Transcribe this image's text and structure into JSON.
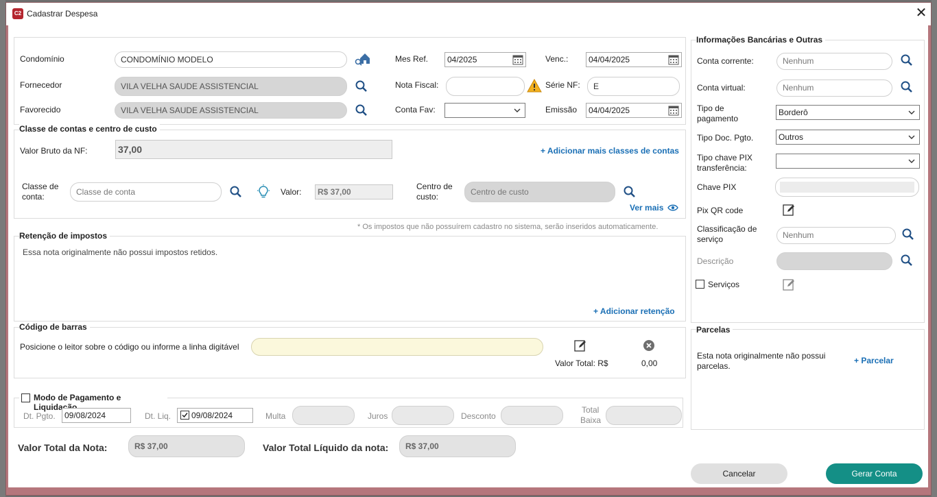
{
  "window": {
    "title": "Cadastrar Despesa",
    "close": "✕",
    "app_icon": "C2"
  },
  "top": {
    "condominio_label": "Condomínio",
    "condominio_value": "CONDOMÍNIO MODELO",
    "fornecedor_label": "Fornecedor",
    "fornecedor_value": "VILA VELHA SAUDE ASSISTENCIAL",
    "favorecido_label": "Favorecido",
    "favorecido_value": "VILA VELHA SAUDE ASSISTENCIAL",
    "mes_ref_label": "Mes Ref.",
    "mes_ref_value": "04/2025",
    "nota_fiscal_label": "Nota Fiscal:",
    "nota_fiscal_value": "",
    "conta_fav_label": "Conta Fav:",
    "conta_fav_value": "",
    "venc_label": "Venc.:",
    "venc_value": "04/04/2025",
    "serie_nf_label": "Série NF:",
    "serie_nf_value": "E",
    "emissao_label": "Emissão",
    "emissao_value": "04/04/2025"
  },
  "classes": {
    "title": "Classe de contas e centro de custo",
    "valor_bruto_label": "Valor Bruto da NF:",
    "valor_bruto_value": "37,00",
    "add_link": "+ Adicionar mais classes de contas",
    "classe_label_1": "Classe de",
    "classe_label_2": "conta:",
    "classe_placeholder": "Classe de conta",
    "valor_label": "Valor:",
    "valor_value": "R$ 37,00",
    "centro_label_1": "Centro de",
    "centro_label_2": "custo:",
    "centro_placeholder": "Centro de custo",
    "ver_mais": "Ver mais",
    "note": "* Os impostos que não possuírem cadastro no sistema, serão inseridos automaticamente."
  },
  "retencao": {
    "title": "Retenção de impostos",
    "text": "Essa nota originalmente não possui impostos retidos.",
    "add_link": "+ Adicionar retenção"
  },
  "barcode": {
    "title": "Código de barras",
    "label": "Posicione o leitor sobre o código ou informe a linha digitável",
    "value": "",
    "valor_total_label": "Valor Total: R$",
    "valor_total_value": "0,00"
  },
  "pagamento": {
    "title": "Modo de Pagamento e Liquidação",
    "dt_pgto_label": "Dt. Pgto.",
    "dt_pgto_value": "09/08/2024",
    "dt_liq_label": "Dt. Liq.",
    "dt_liq_value": "09/08/2024",
    "multa_label": "Multa",
    "juros_label": "Juros",
    "desconto_label": "Desconto",
    "total_baixa_label_1": "Total",
    "total_baixa_label_2": "Baixa"
  },
  "totals": {
    "valor_total_label": "Valor Total da Nota:",
    "valor_total_value": "R$ 37,00",
    "valor_liquido_label": "Valor Total Líquido da nota:",
    "valor_liquido_value": "R$ 37,00"
  },
  "banco": {
    "title": "Informações Bancárias e Outras",
    "conta_corrente_label": "Conta corrente:",
    "conta_corrente_placeholder": "Nenhum",
    "conta_virtual_label": "Conta virtual:",
    "conta_virtual_placeholder": "Nenhum",
    "tipo_pagamento_label_1": "Tipo de",
    "tipo_pagamento_label_2": "pagamento",
    "tipo_pagamento_value": "Borderô",
    "tipo_doc_label": "Tipo Doc. Pgto.",
    "tipo_doc_value": "Outros",
    "tipo_pix_label_1": "Tipo chave PIX",
    "tipo_pix_label_2": "transferência:",
    "tipo_pix_value": "",
    "chave_pix_label": "Chave PIX",
    "pix_qr_label": "Pix QR code",
    "classificacao_label_1": "Classificação de",
    "classificacao_label_2": "serviço",
    "classificacao_placeholder": "Nenhum",
    "descricao_label": "Descrição",
    "servicos_label": "Serviços"
  },
  "parcelas": {
    "title": "Parcelas",
    "text_1": "Esta nota originalmente não possui",
    "text_2": "parcelas.",
    "add_link": "+ Parcelar"
  },
  "buttons": {
    "cancel": "Cancelar",
    "submit": "Gerar Conta"
  },
  "colors": {
    "accent": "#148f86",
    "link": "#1a6fb5",
    "frame": "#b5767c"
  }
}
